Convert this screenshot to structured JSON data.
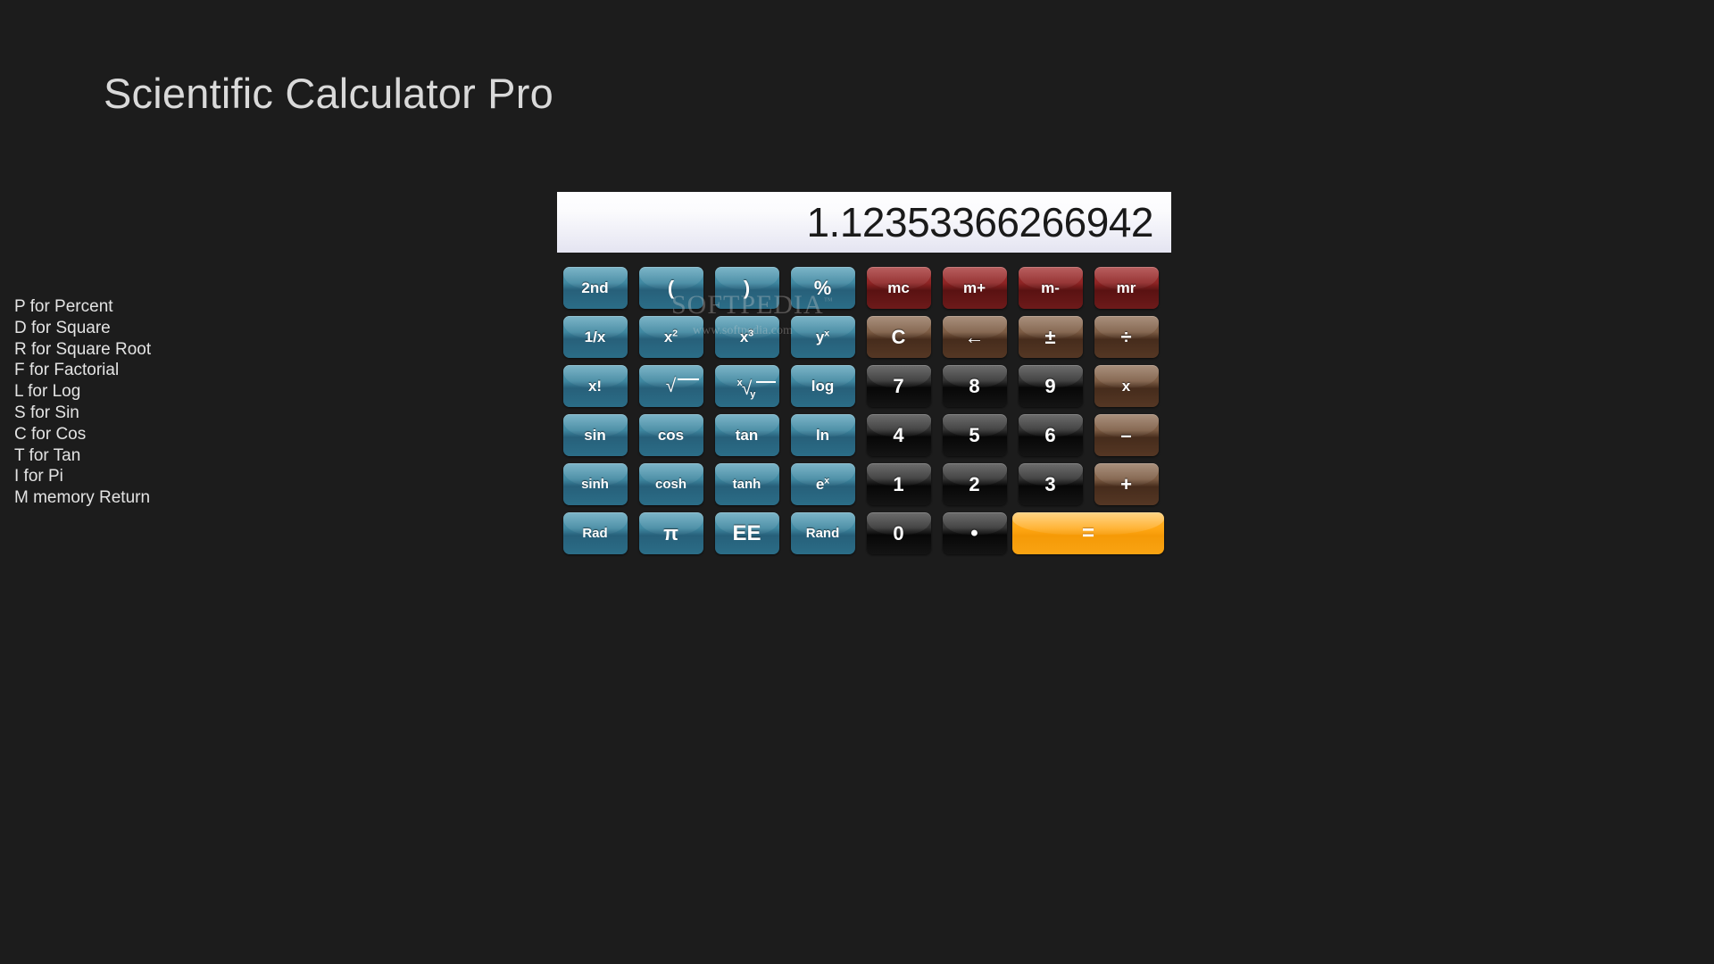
{
  "app": {
    "title": "Scientific Calculator Pro",
    "background_color": "#1c1c1c"
  },
  "help": {
    "lines": [
      "P for Percent",
      "D for Square",
      "R for Square Root",
      "F for Factorial",
      "L for Log",
      "S for Sin",
      "C for Cos",
      "T for Tan",
      "I for Pi",
      "M memory Return"
    ]
  },
  "display": {
    "value": "1.12353366266942"
  },
  "watermark": {
    "main": "SOFTPEDIA",
    "trademark": "™",
    "sub": "www.softpedia.com"
  },
  "colors": {
    "teal": "#3f87a0",
    "red": "#8e2424",
    "brown": "#7c5c44",
    "dark": "#333333",
    "orange": "#ffa613",
    "display_text": "#1a1a1a",
    "title_text": "#d9d9d9"
  },
  "keypad": {
    "rows": [
      [
        {
          "name": "key-2nd",
          "label": "2nd",
          "style": "teal",
          "size": "md"
        },
        {
          "name": "key-paren-open",
          "label": "(",
          "style": "teal",
          "size": "lg"
        },
        {
          "name": "key-paren-close",
          "label": ")",
          "style": "teal",
          "size": "lg"
        },
        {
          "name": "key-percent",
          "label": "%",
          "style": "teal",
          "size": "lg"
        },
        {
          "name": "key-mc",
          "label": "mc",
          "style": "red",
          "size": "md"
        },
        {
          "name": "key-m-plus",
          "label": "m+",
          "style": "red",
          "size": "md"
        },
        {
          "name": "key-m-minus",
          "label": "m-",
          "style": "red",
          "size": "md"
        },
        {
          "name": "key-mr",
          "label": "mr",
          "style": "red",
          "size": "md"
        }
      ],
      [
        {
          "name": "key-reciprocal",
          "label": "1/x",
          "style": "teal",
          "size": "md"
        },
        {
          "name": "key-x-squared",
          "label": "x2",
          "style": "teal",
          "size": "md",
          "sup": "2",
          "base": "x"
        },
        {
          "name": "key-x-cubed",
          "label": "x3",
          "style": "teal",
          "size": "md",
          "sup": "3",
          "base": "x"
        },
        {
          "name": "key-y-to-x",
          "label": "yx",
          "style": "teal",
          "size": "md",
          "sup": "x",
          "base": "y"
        },
        {
          "name": "key-clear",
          "label": "C",
          "style": "brown",
          "size": "lg"
        },
        {
          "name": "key-backspace",
          "label": "←",
          "style": "brown",
          "size": "lg"
        },
        {
          "name": "key-plus-minus",
          "label": "±",
          "style": "brown",
          "size": "lg"
        },
        {
          "name": "key-divide",
          "label": "÷",
          "style": "brown",
          "size": "lg"
        }
      ],
      [
        {
          "name": "key-factorial",
          "label": "x!",
          "style": "teal",
          "size": "md"
        },
        {
          "name": "key-sqrt",
          "label": "√",
          "style": "teal",
          "size": "md",
          "glyph": "sqrt"
        },
        {
          "name": "key-nth-root",
          "label": "x√y",
          "style": "teal",
          "size": "md",
          "glyph": "nthroot"
        },
        {
          "name": "key-log",
          "label": "log",
          "style": "teal",
          "size": "md"
        },
        {
          "name": "key-7",
          "label": "7",
          "style": "dark",
          "size": "lg"
        },
        {
          "name": "key-8",
          "label": "8",
          "style": "dark",
          "size": "lg"
        },
        {
          "name": "key-9",
          "label": "9",
          "style": "dark",
          "size": "lg"
        },
        {
          "name": "key-multiply",
          "label": "x",
          "style": "brown",
          "size": "md"
        }
      ],
      [
        {
          "name": "key-sin",
          "label": "sin",
          "style": "teal",
          "size": "md"
        },
        {
          "name": "key-cos",
          "label": "cos",
          "style": "teal",
          "size": "md"
        },
        {
          "name": "key-tan",
          "label": "tan",
          "style": "teal",
          "size": "md"
        },
        {
          "name": "key-ln",
          "label": "ln",
          "style": "teal",
          "size": "md"
        },
        {
          "name": "key-4",
          "label": "4",
          "style": "dark",
          "size": "lg"
        },
        {
          "name": "key-5",
          "label": "5",
          "style": "dark",
          "size": "lg"
        },
        {
          "name": "key-6",
          "label": "6",
          "style": "dark",
          "size": "lg"
        },
        {
          "name": "key-subtract",
          "label": "–",
          "style": "brown",
          "size": "lg"
        }
      ],
      [
        {
          "name": "key-sinh",
          "label": "sinh",
          "style": "teal",
          "size": "sm"
        },
        {
          "name": "key-cosh",
          "label": "cosh",
          "style": "teal",
          "size": "sm"
        },
        {
          "name": "key-tanh",
          "label": "tanh",
          "style": "teal",
          "size": "sm"
        },
        {
          "name": "key-e-to-x",
          "label": "ex",
          "style": "teal",
          "size": "md",
          "sup": "x",
          "base": "e"
        },
        {
          "name": "key-1",
          "label": "1",
          "style": "dark",
          "size": "lg"
        },
        {
          "name": "key-2",
          "label": "2",
          "style": "dark",
          "size": "lg"
        },
        {
          "name": "key-3",
          "label": "3",
          "style": "dark",
          "size": "lg"
        },
        {
          "name": "key-add",
          "label": "+",
          "style": "brown",
          "size": "lg"
        }
      ],
      [
        {
          "name": "key-rad",
          "label": "Rad",
          "style": "teal",
          "size": "sm"
        },
        {
          "name": "key-pi",
          "label": "π",
          "style": "teal",
          "size": "lg"
        },
        {
          "name": "key-ee",
          "label": "EE",
          "style": "teal",
          "size": "xl"
        },
        {
          "name": "key-rand",
          "label": "Rand",
          "style": "teal",
          "size": "sm"
        },
        {
          "name": "key-0",
          "label": "0",
          "style": "dark",
          "size": "lg"
        },
        {
          "name": "key-decimal",
          "label": "•",
          "style": "dark",
          "size": "xl"
        },
        {
          "name": "key-equals",
          "label": "=",
          "style": "orange",
          "size": "xl",
          "wide": true
        }
      ]
    ]
  }
}
